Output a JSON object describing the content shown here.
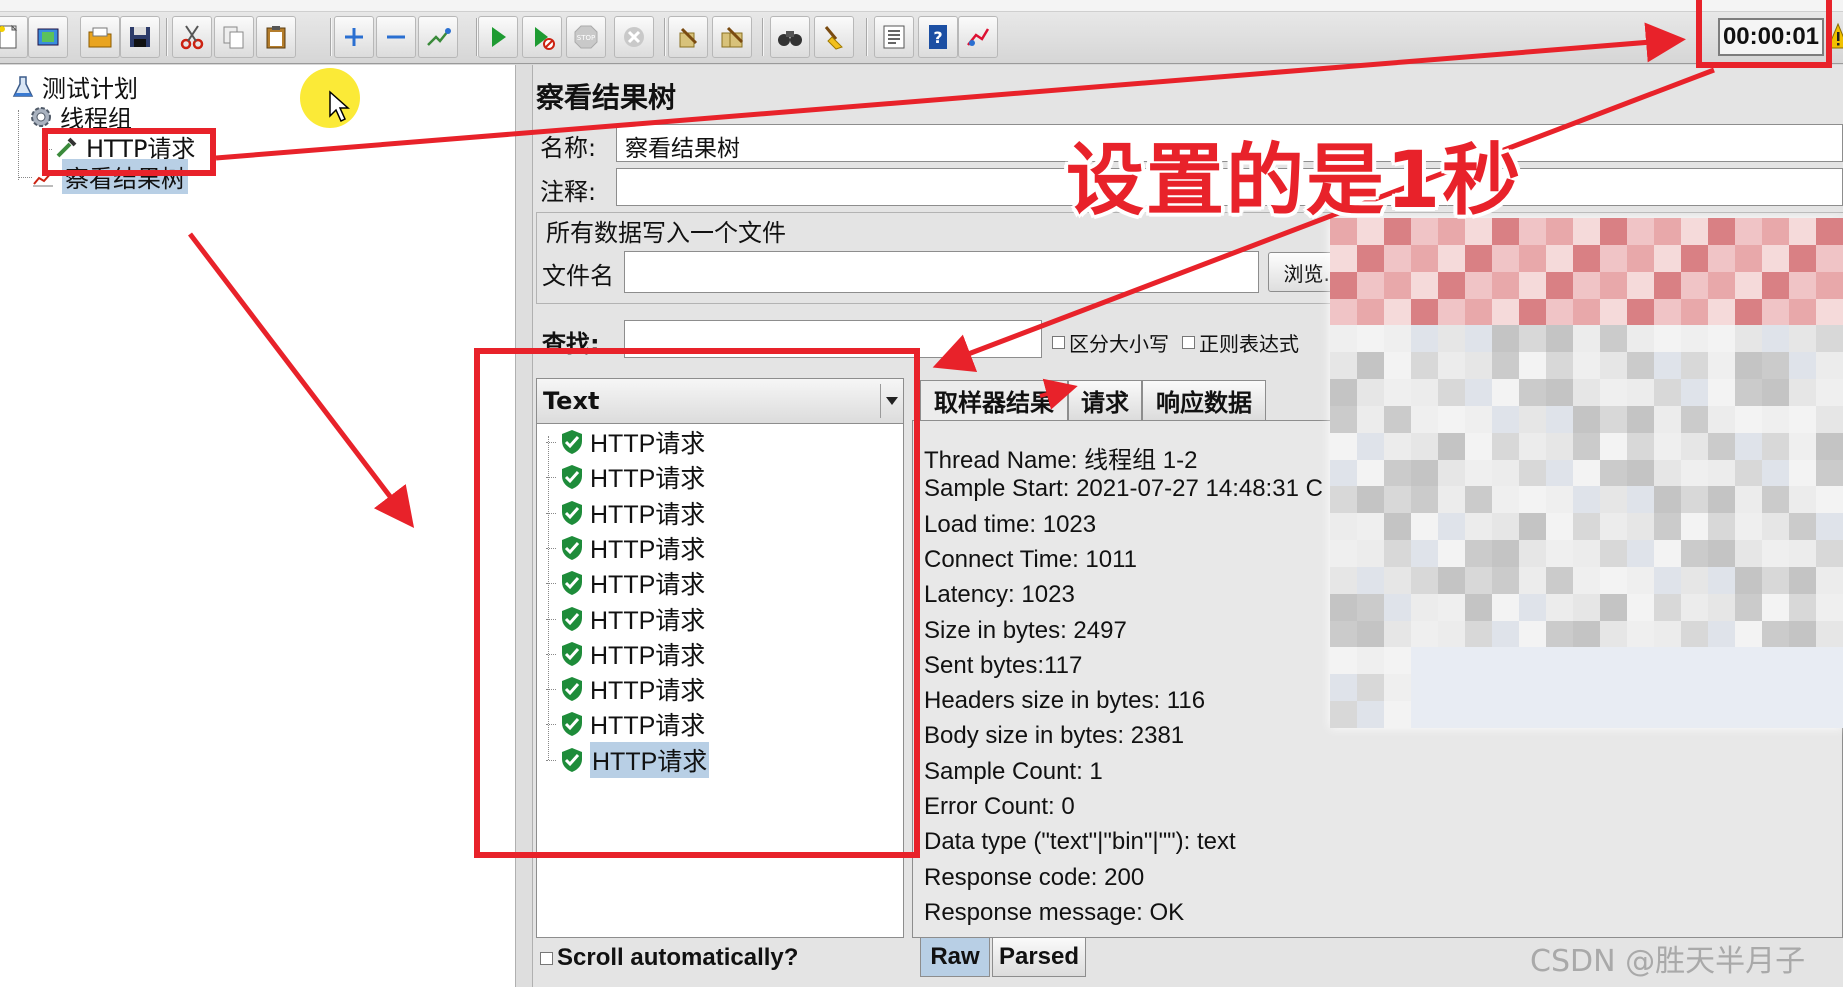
{
  "toolbar": {
    "buttons": [
      "new-icon",
      "templates-icon",
      "open-icon",
      "save-icon",
      "cut-icon",
      "copy-icon",
      "paste-icon",
      "expand-icon",
      "collapse-icon",
      "toggle-icon",
      "start-icon",
      "start-no-pause-icon",
      "stop-icon",
      "shutdown-icon",
      "clear-icon",
      "clear-all-icon",
      "search-icon",
      "reset-search-icon",
      "function-helper-icon",
      "help-icon",
      "remote-icon"
    ],
    "timer": "00:00:01"
  },
  "tree": {
    "test_plan": "测试计划",
    "thread_group": "线程组",
    "http_request": "HTTP请求",
    "view_results_tree": "察看结果树"
  },
  "panel": {
    "title": "察看结果树",
    "name_label": "名称:",
    "name_value": "察看结果树",
    "comment_label": "注释:",
    "comment_value": "",
    "file_group_title": "所有数据写入一个文件",
    "filename_label": "文件名",
    "filename_value": "",
    "browse_button": "浏览...",
    "search_label": "查找:",
    "search_value": "",
    "case_sensitive": "区分大小写",
    "regex": "正则表达式"
  },
  "results": {
    "renderer": "Text",
    "items": [
      "HTTP请求",
      "HTTP请求",
      "HTTP请求",
      "HTTP请求",
      "HTTP请求",
      "HTTP请求",
      "HTTP请求",
      "HTTP请求",
      "HTTP请求",
      "HTTP请求"
    ],
    "scroll_auto": "Scroll automatically?"
  },
  "tabs": {
    "sampler_result": "取样器结果",
    "request": "请求",
    "response_data": "响应数据"
  },
  "details": [
    "Thread Name: 线程组 1-2",
    "Sample Start: 2021-07-27 14:48:31 C",
    "Load time: 1023",
    "Connect Time: 1011",
    "Latency: 1023",
    "Size in bytes: 2497",
    "Sent bytes:117",
    "Headers size in bytes: 116",
    "Body size in bytes: 2381",
    "Sample Count: 1",
    "Error Count: 0",
    "Data type (\"text\"|\"bin\"|\"\"): text",
    "Response code: 200",
    "Response message: OK"
  ],
  "bottom_tabs": {
    "raw": "Raw",
    "parsed": "Parsed"
  },
  "annotation": {
    "text": "设置的是1秒"
  },
  "watermark": "CSDN @胜天半月子",
  "colors": {
    "annotation_red": "#e8222a",
    "selection_blue": "#b8cfe5",
    "success_green": "#1e8c3a"
  }
}
